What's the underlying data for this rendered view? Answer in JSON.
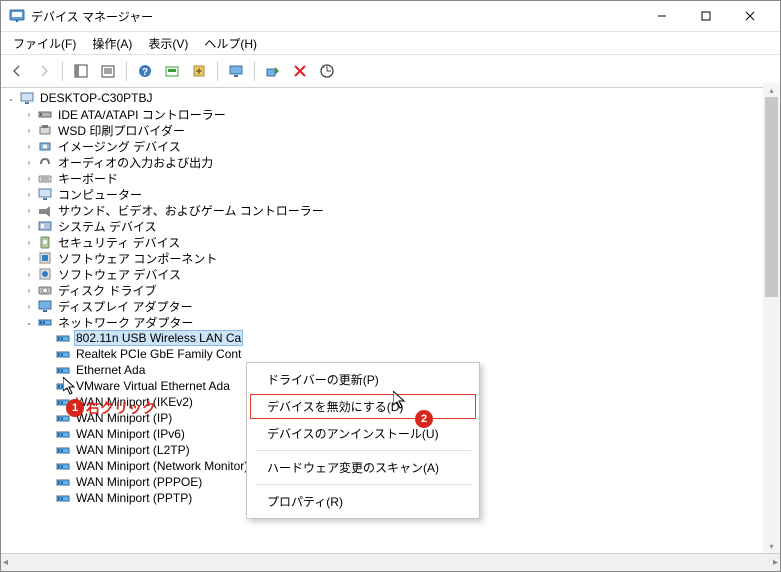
{
  "window": {
    "title": "デバイス マネージャー"
  },
  "menubar": {
    "file": "ファイル(F)",
    "action": "操作(A)",
    "view": "表示(V)",
    "help": "ヘルプ(H)"
  },
  "tree": {
    "root": "DESKTOP-C30PTBJ",
    "categories": [
      "IDE ATA/ATAPI コントローラー",
      "WSD 印刷プロバイダー",
      "イメージング デバイス",
      "オーディオの入力および出力",
      "キーボード",
      "コンピューター",
      "サウンド、ビデオ、およびゲーム コントローラー",
      "システム デバイス",
      "セキュリティ デバイス",
      "ソフトウェア コンポーネント",
      "ソフトウェア デバイス",
      "ディスク ドライブ",
      "ディスプレイ アダプター",
      "ネットワーク アダプター"
    ],
    "network_adapters": [
      "802.11n USB Wireless LAN Ca",
      "Realtek PCIe GbE Family Cont",
      "Ethernet Ada",
      "VMware Virtual Ethernet Ada",
      "WAN Miniport (IKEv2)",
      "WAN Miniport (IP)",
      "WAN Miniport (IPv6)",
      "WAN Miniport (L2TP)",
      "WAN Miniport (Network Monitor)",
      "WAN Miniport (PPPOE)",
      "WAN Miniport (PPTP)"
    ]
  },
  "context_menu": {
    "update_driver": "ドライバーの更新(P)",
    "disable_device": "デバイスを無効にする(D)",
    "uninstall_device": "デバイスのアンインストール(U)",
    "scan_hardware": "ハードウェア変更のスキャン(A)",
    "properties": "プロパティ(R)"
  },
  "annotations": {
    "label1_num": "1",
    "label1_text": "右クリック",
    "label2_num": "2"
  }
}
